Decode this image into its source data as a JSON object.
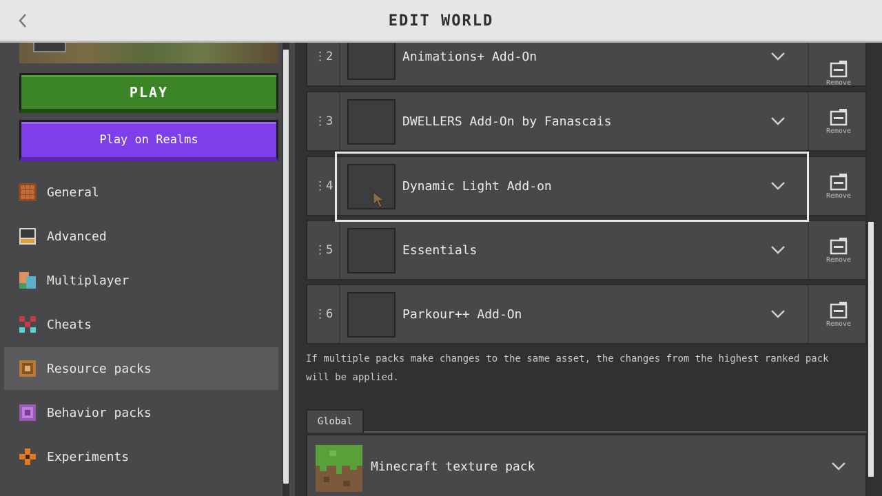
{
  "header": {
    "title": "EDIT WORLD",
    "back_icon": "chevron-left-icon"
  },
  "sidebar": {
    "play_label": "PLAY",
    "realms_label": "Play on Realms",
    "items": [
      {
        "label": "General",
        "icon": "general-icon"
      },
      {
        "label": "Advanced",
        "icon": "advanced-icon"
      },
      {
        "label": "Multiplayer",
        "icon": "multiplayer-icon"
      },
      {
        "label": "Cheats",
        "icon": "cheats-icon"
      },
      {
        "label": "Resource packs",
        "icon": "resource-packs-icon",
        "selected": true
      },
      {
        "label": "Behavior packs",
        "icon": "behavior-packs-icon"
      },
      {
        "label": "Experiments",
        "icon": "experiments-icon"
      }
    ]
  },
  "packs": [
    {
      "rank": "2",
      "name": "Animations+ Add-On"
    },
    {
      "rank": "3",
      "name": "DWELLERS Add-On by Fanascais"
    },
    {
      "rank": "4",
      "name": "Dynamic Light Add-on"
    },
    {
      "rank": "5",
      "name": "Essentials"
    },
    {
      "rank": "6",
      "name": "Parkour++ Add-On"
    }
  ],
  "remove_label": "Remove",
  "info_text": "If multiple packs make changes to the same asset, the changes from the highest ranked pack will be applied.",
  "global": {
    "tab_label": "Global",
    "pack_name": "Minecraft texture pack"
  },
  "colors": {
    "play": "#3c8527",
    "realms": "#7f3fe8",
    "panel": "#48474a",
    "background": "#313033"
  }
}
